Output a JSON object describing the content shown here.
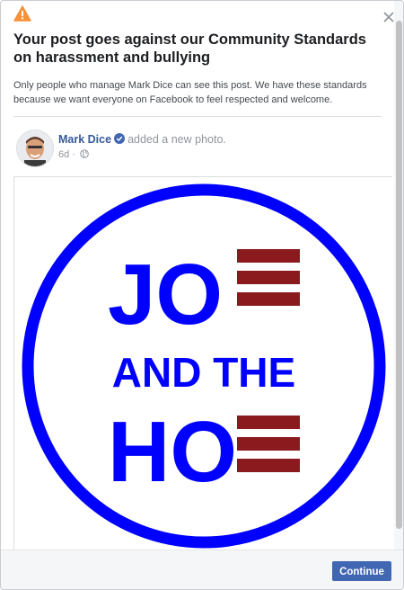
{
  "dialog": {
    "title": "Your post goes against our Community Standards on harassment and bullying",
    "subtitle": "Only people who manage Mark Dice can see this post. We have these standards because we want everyone on Facebook to feel respected and welcome."
  },
  "post": {
    "author_name": "Mark Dice",
    "action_text": "added a new photo.",
    "timestamp": "6d",
    "separator": "·",
    "image_text": {
      "line1": "JO",
      "line2": "AND THE",
      "line3": "HO"
    }
  },
  "footer": {
    "continue_label": "Continue"
  },
  "colors": {
    "warning": "#f7923b",
    "logo_blue": "#0000ff",
    "logo_red": "#8b1a1f",
    "button": "#4267b2",
    "link": "#365899"
  },
  "icons": {
    "warning": "warning-triangle-icon",
    "close": "close-icon",
    "verified": "verified-badge-icon",
    "privacy": "globe-icon"
  }
}
